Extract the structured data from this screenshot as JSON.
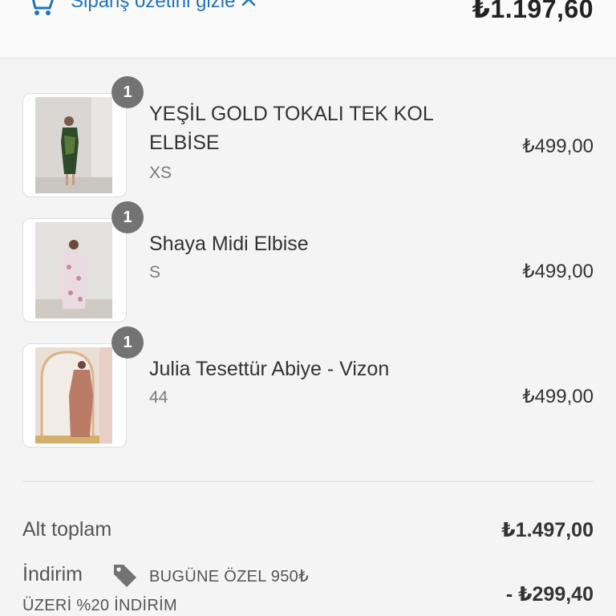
{
  "header": {
    "toggle_label": "Sipariş özetini gizle",
    "total": "₺1.197,60"
  },
  "items": [
    {
      "qty": "1",
      "name": "YEŞİL GOLD TOKALI TEK KOL ELBİSE",
      "variant": "XS",
      "price": "₺499,00"
    },
    {
      "qty": "1",
      "name": "Shaya Midi Elbise",
      "variant": "S",
      "price": "₺499,00"
    },
    {
      "qty": "1",
      "name": "Julia Tesettür Abiye - Vizon",
      "variant": "44",
      "price": "₺499,00"
    }
  ],
  "summary": {
    "subtotal_label": "Alt toplam",
    "subtotal_value": "₺1.497,00",
    "discount_label": "İndirim",
    "discount_code_line1": "BUGÜNE ÖZEL 950₺",
    "discount_code_line2": "ÜZERİ %20 İNDİRİM",
    "discount_value": "- ₺299,40"
  },
  "icons": {
    "cart": "cart-icon",
    "chevron": "chevron-up-icon",
    "tag": "tag-icon"
  },
  "colors": {
    "link": "#1f74b8",
    "badge": "#737373"
  }
}
